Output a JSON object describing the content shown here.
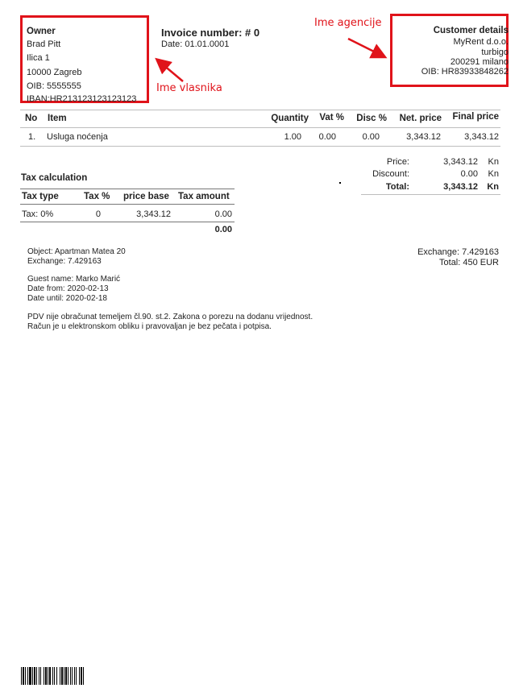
{
  "owner": {
    "title": "Owner",
    "lines": [
      "Brad Pitt",
      "Ilica 1",
      "10000 Zagreb",
      "OIB: 5555555",
      "IBAN:HR213123123123123"
    ]
  },
  "invoice": {
    "number_label": "Invoice number: # 0",
    "date_label": "Date: 01.01.0001"
  },
  "customer": {
    "title": "Customer details",
    "lines": [
      "MyRent d.o.o.",
      "turbigo",
      "200291 milano",
      "OIB: HR83933848262"
    ]
  },
  "annotations": {
    "owner_label": "Ime vlasnika",
    "agency_label": "Ime agencije",
    "color": "#e0131a"
  },
  "items_table": {
    "headers": [
      "No",
      "Item",
      "Quantity",
      "Vat %",
      "Disc %",
      "Net. price",
      "Final price"
    ],
    "rows": [
      [
        "1.",
        "Usluga noćenja",
        "1.00",
        "0.00",
        "0.00",
        "3,343.12",
        "3,343.12"
      ]
    ]
  },
  "totals": {
    "price_label": "Price:",
    "price_value": "3,343.12",
    "price_unit": "Kn",
    "discount_label": "Discount:",
    "discount_value": "0.00",
    "discount_unit": "Kn",
    "total_label": "Total:",
    "total_value": "3,343.12",
    "total_unit": "Kn"
  },
  "tax": {
    "title": "Tax calculation",
    "headers": [
      "Tax type",
      "Tax %",
      "price base",
      "Tax amount"
    ],
    "rows": [
      [
        "Tax: 0%",
        "0",
        "3,343.12",
        "0.00"
      ]
    ],
    "total": "0.00"
  },
  "details": {
    "object": "Object: Apartman Matea 20",
    "exchange_left": "Exchange: 7.429163",
    "guest": "Guest name: Marko Marić",
    "date_from": "Date from: 2020-02-13",
    "date_until": "Date until: 2020-02-18",
    "exchange_right": "Exchange: 7.429163",
    "total_right": "Total: 450 EUR"
  },
  "notes": [
    "PDV nije obračunat temeljem čl.90. st.2. Zakona o porezu na dodanu vrijednost.",
    "Račun je u elektronskom obliku i pravovaljan je bez pečata i potpisa."
  ],
  "barcode_icon": "barcode-icon"
}
